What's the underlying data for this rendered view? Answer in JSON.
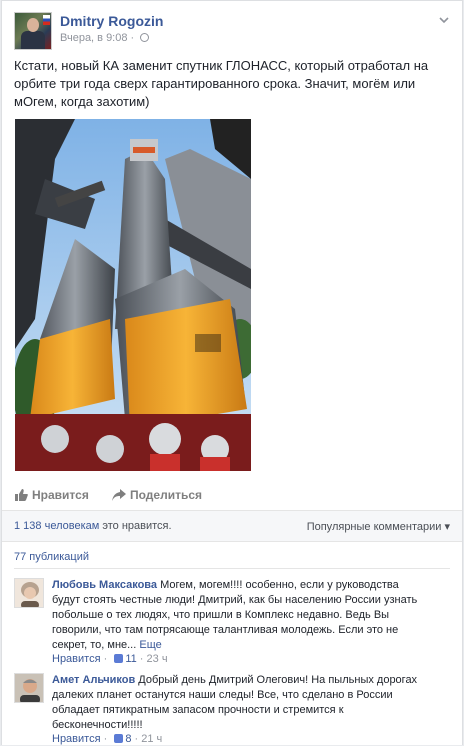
{
  "post": {
    "author": "Dmitry Rogozin",
    "time": "Вчера, в 9:08",
    "dot": "·",
    "text": "Кстати, новый КА заменит спутник ГЛОНАСС, который отработал на орбите три года сверх гарантированного срока. Значит, могём или мОгем, когда захотим)"
  },
  "actions": {
    "like_label": "Нравится",
    "share_label": "Поделиться"
  },
  "stats": {
    "likes_count": "1 138 человекам",
    "likes_suffix": " это нравится.",
    "sort_label": "Популярные комментарии",
    "sort_arrow": "▾",
    "shares": "77 публикаций"
  },
  "comments": [
    {
      "name": "Любовь Максакова",
      "text": " Могем, могем!!!! особенно, если у руководства будут стоять честные люди! Дмитрий, как бы населению России узнать побольше о тех людях, что пришли в Комплекс недавно. Ведь Вы говорили, что там потрясающе талантливая молодежь. Если это не секрет, то, мне...",
      "more": " Еще",
      "like_label": "Нравится",
      "dot": " · ",
      "likes": "11",
      "time": "23 ч"
    },
    {
      "name": "Амет Альчиков",
      "text": " Добрый день Дмитрий Олегович! На пыльных дорогах далеких планет останутся наши следы! Все, что сделано в России обладает пятикратным запасом прочности и стремится к бесконечности!!!!!",
      "like_label": "Нравится",
      "dot": " · ",
      "likes": "8",
      "time": "21 ч"
    }
  ],
  "colors": {
    "link": "#3b5998",
    "rocket_orange": "#f5a623",
    "sky": "#9fc7ef"
  },
  "icons": {
    "menu": "chevron-down-icon",
    "privacy": "globe-icon",
    "like": "thumbs-up-icon",
    "share": "share-arrow-icon"
  }
}
